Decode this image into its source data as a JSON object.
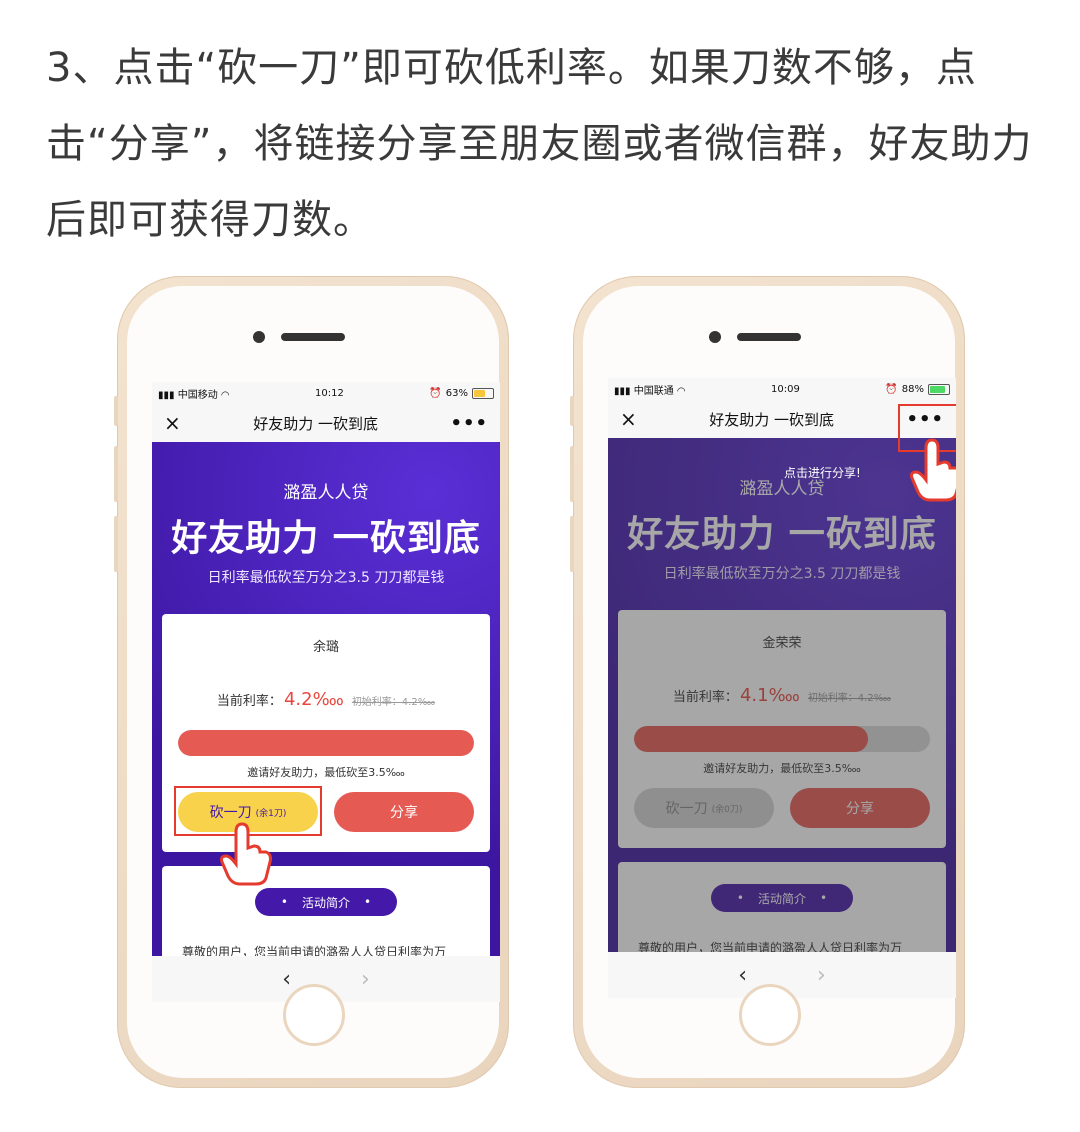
{
  "instruction": "3、点击“砍一刀”即可砍低利率。如果刀数不够，点击“分享”，将链接分享至朋友圈或者微信群，好友助力后即可获得刀数。",
  "colors": {
    "accent_red": "#e55a52",
    "yellow": "#f7d24a",
    "purple": "#4418a8",
    "highlight": "#e53b2f"
  },
  "phones": [
    {
      "status": {
        "carrier": "中国移动",
        "time": "10:12",
        "battery": "63%",
        "battery_level": 0.63
      },
      "title": "好友助力 一砍到底",
      "close_icon": "×",
      "more_icon": "•••",
      "brand": "潞盈人人贷",
      "slogan": "好友助力 一砍到底",
      "subtitle": "日利率最低砍至万分之3.5   刀刀都是钱",
      "friend_name": "余璐",
      "current_rate_label": "当前利率：",
      "current_rate": "4.2‱",
      "initial_rate": "初始利率：4.2‱",
      "progress": 1.0,
      "invite_text": "邀请好友助力，最低砍至3.5‱",
      "cut_button": "砍一刀",
      "cut_remaining": "(余1刀)",
      "share_button": "分享",
      "section_pill": "活动简介",
      "description": "尊敬的用户，您当前申请的潞盈人人贷日利率为万",
      "nav_back": "‹",
      "nav_forward": "›"
    },
    {
      "status": {
        "carrier": "中国联通",
        "time": "10:09",
        "battery": "88%",
        "battery_level": 0.88
      },
      "title": "好友助力 一砍到底",
      "close_icon": "×",
      "more_icon": "•••",
      "brand": "潞盈人人贷",
      "slogan": "好友助力 一砍到底",
      "subtitle": "日利率最低砍至万分之3.5   刀刀都是钱",
      "share_hint": "点击进行分享!",
      "friend_name": "金荣荣",
      "current_rate_label": "当前利率：",
      "current_rate": "4.1‱",
      "initial_rate": "初始利率：4.2‱",
      "progress": 0.79,
      "invite_text": "邀请好友助力，最低砍至3.5‱",
      "cut_button": "砍一刀",
      "cut_remaining": "(余0刀)",
      "share_button": "分享",
      "section_pill": "活动简介",
      "description": "尊敬的用户，您当前申请的潞盈人人贷日利率为万",
      "nav_back": "‹",
      "nav_forward": "›"
    }
  ]
}
